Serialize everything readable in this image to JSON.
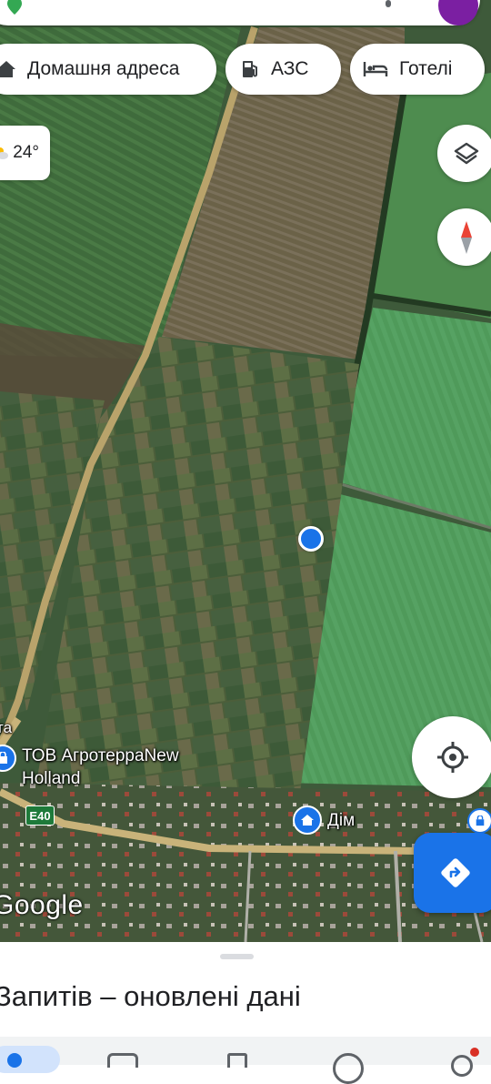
{
  "quick_chips": {
    "home": "Домашня адреса",
    "gas": "АЗС",
    "hotels": "Готелі"
  },
  "weather": {
    "temperature": "24°"
  },
  "map": {
    "business_label": "ТОВ АгротерраNew Holland",
    "business_label_line1": "ТОВ АгротерраNew",
    "business_label_line2": "Holland",
    "edge_label_fragment": "та",
    "road_shield": "E40",
    "home_label": "Дім",
    "logo": "Google"
  },
  "bottom_sheet": {
    "title": "Запитів – оновлені дані"
  },
  "colors": {
    "accent": "#1a73e8",
    "location_dot": "#1a73e8",
    "profile": "#7b1fa2"
  },
  "icons": [
    "home-icon",
    "gas-station-icon",
    "hotel-icon",
    "layers-icon",
    "compass-icon",
    "my-location-icon",
    "directions-icon",
    "place-pin-icon",
    "home-pin-icon"
  ]
}
